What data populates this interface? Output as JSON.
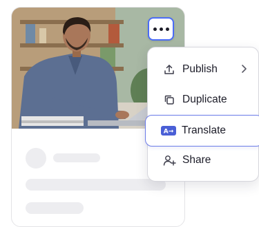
{
  "menu": {
    "items": [
      {
        "label": "Publish",
        "icon": "upload-icon"
      },
      {
        "label": "Duplicate",
        "icon": "duplicate-icon"
      },
      {
        "label": "Translate",
        "icon": "translate-icon",
        "badge": "A→",
        "highlighted": true
      },
      {
        "label": "Share",
        "icon": "add-user-icon"
      }
    ]
  },
  "colors": {
    "accent": "#4a6cf7",
    "highlight_border": "#6b7be8",
    "text": "#1c1c28",
    "skeleton": "#ededf0"
  }
}
